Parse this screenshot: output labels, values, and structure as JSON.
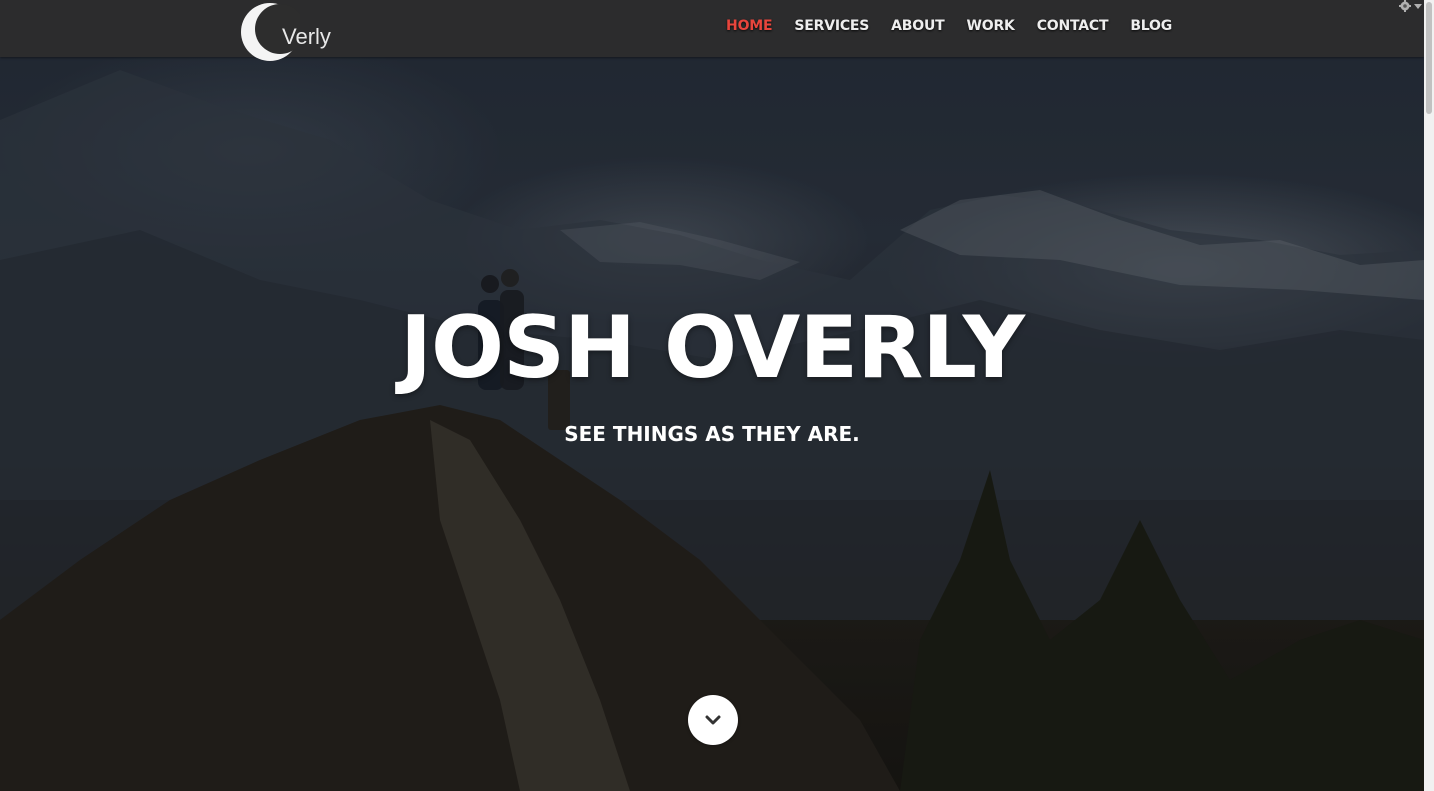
{
  "brand": {
    "logo_text": "Verly",
    "logo_icon": "crescent-moon-icon"
  },
  "nav": {
    "items": [
      {
        "label": "HOME",
        "active": true
      },
      {
        "label": "SERVICES",
        "active": false
      },
      {
        "label": "ABOUT",
        "active": false
      },
      {
        "label": "WORK",
        "active": false
      },
      {
        "label": "CONTACT",
        "active": false
      },
      {
        "label": "BLOG",
        "active": false
      }
    ],
    "active_color": "#e8453c",
    "text_color": "#eeeeee"
  },
  "hero": {
    "title": "JOSH OVERLY",
    "subtitle": "SEE THINGS AS THEY ARE.",
    "scroll_icon": "chevron-down-icon"
  },
  "controls": {
    "settings_icon": "gear-icon"
  }
}
